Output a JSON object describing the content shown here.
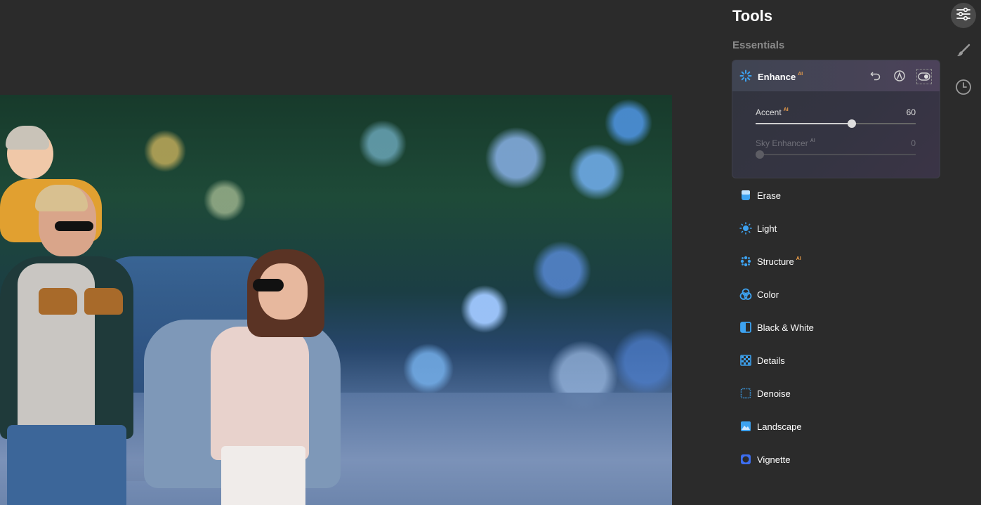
{
  "panel": {
    "title": "Tools",
    "section": "Essentials"
  },
  "enhance": {
    "label": "Enhance",
    "badge": "AI",
    "icon": "sparkle-icon",
    "sliders": [
      {
        "label": "Accent",
        "badge": "AI",
        "value": "60",
        "fraction": 0.6,
        "enabled": true
      },
      {
        "label": "Sky Enhancer",
        "badge": "AI",
        "value": "0",
        "fraction": 0.0,
        "enabled": false
      }
    ]
  },
  "tools": [
    {
      "label": "Erase",
      "badge": "",
      "icon": "erase-icon"
    },
    {
      "label": "Light",
      "badge": "",
      "icon": "sun-icon"
    },
    {
      "label": "Structure",
      "badge": "AI",
      "icon": "structure-icon"
    },
    {
      "label": "Color",
      "badge": "",
      "icon": "color-circles-icon"
    },
    {
      "label": "Black & White",
      "badge": "",
      "icon": "half-square-icon"
    },
    {
      "label": "Details",
      "badge": "",
      "icon": "checker-icon"
    },
    {
      "label": "Denoise",
      "badge": "",
      "icon": "denoise-icon"
    },
    {
      "label": "Landscape",
      "badge": "",
      "icon": "landscape-icon"
    },
    {
      "label": "Vignette",
      "badge": "",
      "icon": "vignette-icon"
    }
  ],
  "colors": {
    "accent_blue": "#3d8ef0",
    "ai_badge": "#f0a04a",
    "panel_bg": "#2b2b2b"
  }
}
